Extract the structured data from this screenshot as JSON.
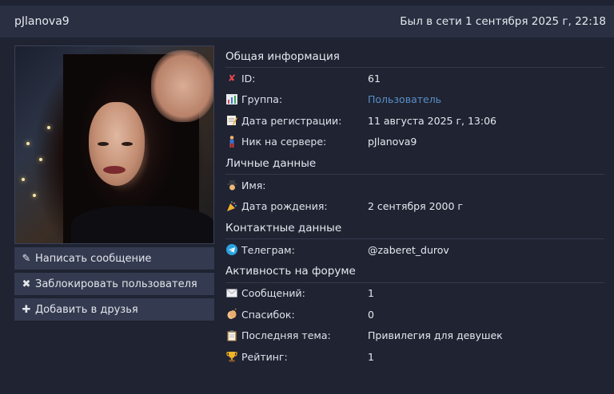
{
  "header": {
    "username": "pJlanova9",
    "last_seen": "Был в сети 1 сентября 2025 г, 22:18"
  },
  "actions": [
    {
      "icon": "pencil-icon",
      "label": "Написать сообщение"
    },
    {
      "icon": "cross-icon",
      "label": "Заблокировать пользователя"
    },
    {
      "icon": "plus-icon",
      "label": "Добавить в друзья"
    }
  ],
  "sections": {
    "general": {
      "title": "Общая информация",
      "rows": [
        {
          "icon": "cross-mark-icon",
          "label": "ID:",
          "value": "61"
        },
        {
          "icon": "bar-chart-icon",
          "label": "Группа:",
          "value": "Пользователь"
        },
        {
          "icon": "memo-icon",
          "label": "Дата регистрации:",
          "value": "11 августа 2025 г, 13:06"
        },
        {
          "icon": "person-standing-icon",
          "label": "Ник на сервере:",
          "value": "pJlanova9"
        }
      ]
    },
    "personal": {
      "title": "Личные данные",
      "rows": [
        {
          "icon": "detective-icon",
          "label": "Имя:",
          "value": ""
        },
        {
          "icon": "party-popper-icon",
          "label": "Дата рождения:",
          "value": "2 сентября 2000 г"
        }
      ]
    },
    "contacts": {
      "title": "Контактные данные",
      "rows": [
        {
          "icon": "telegram-icon",
          "label": "Телеграм:",
          "value": "@zaberet_durov"
        }
      ]
    },
    "activity": {
      "title": "Активность на форуме",
      "rows": [
        {
          "icon": "envelope-icon",
          "label": "Сообщений:",
          "value": "1"
        },
        {
          "icon": "clapping-hands-icon",
          "label": "Спасибок:",
          "value": "0"
        },
        {
          "icon": "clipboard-icon",
          "label": "Последняя тема:",
          "value": "Привилегия для девушек"
        },
        {
          "icon": "trophy-icon",
          "label": "Рейтинг:",
          "value": "1"
        }
      ]
    }
  },
  "colors": {
    "background": "#1f2332",
    "header_bar": "#2a2f41",
    "button": "#343a4f",
    "link": "#5b8fc7"
  }
}
